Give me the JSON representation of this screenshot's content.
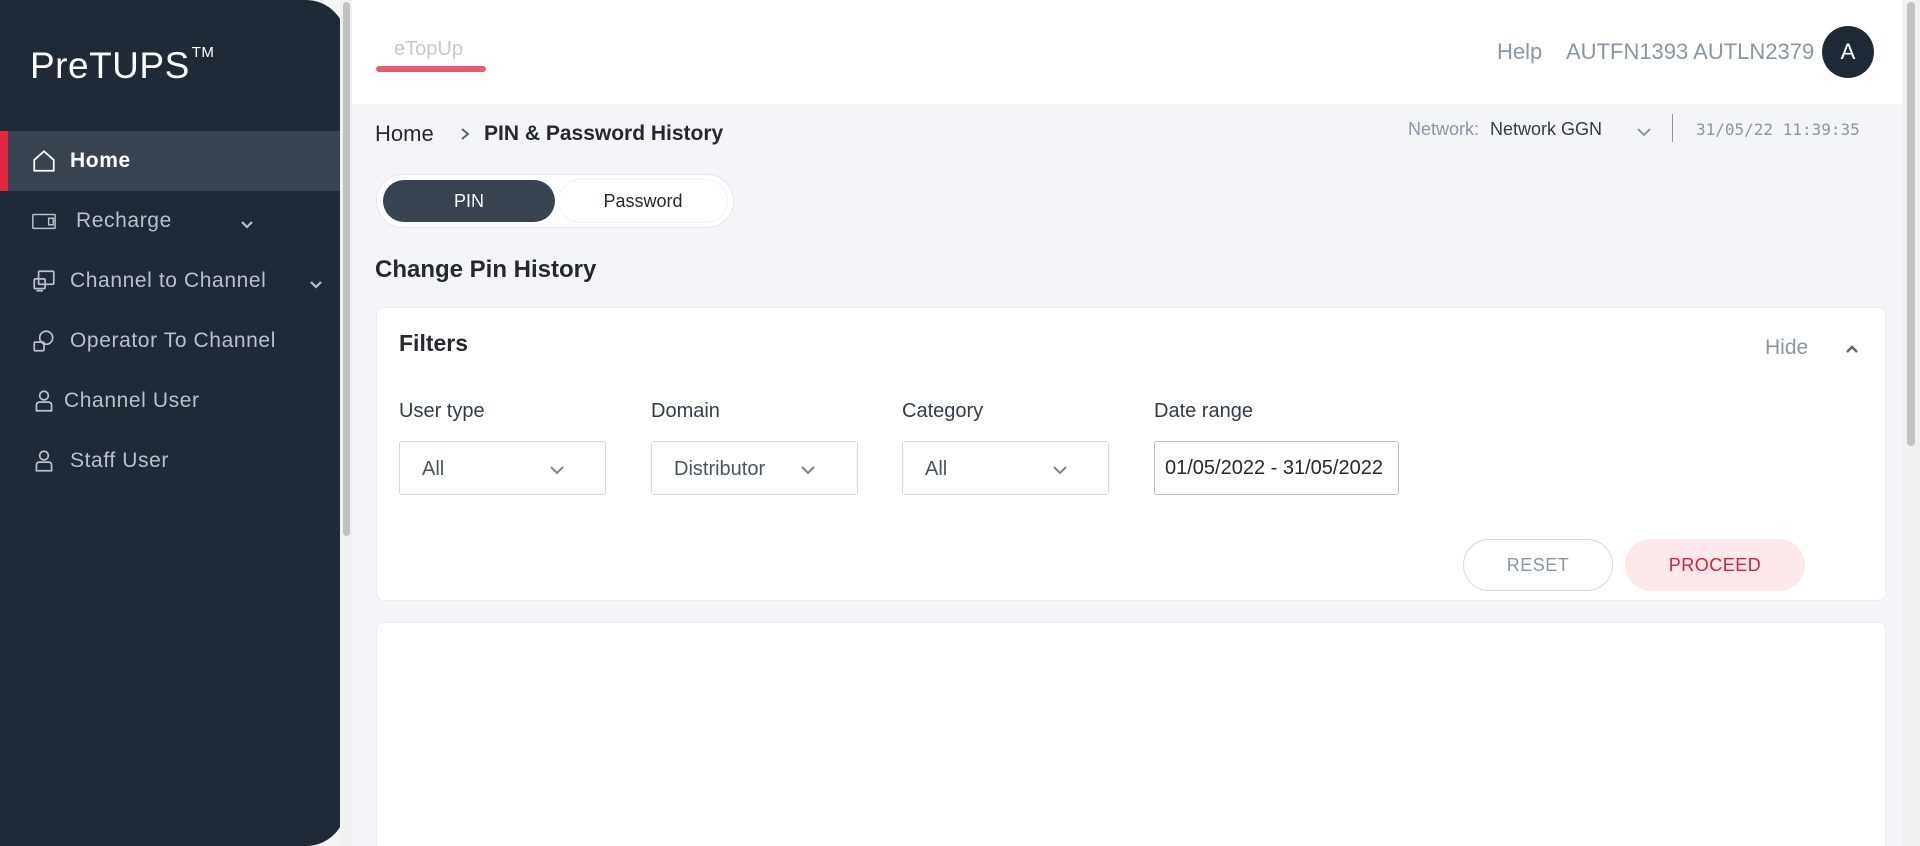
{
  "sidebar": {
    "logo": "PreTUPS",
    "logo_mark": "TM",
    "items": [
      {
        "label": "Home",
        "icon": "home-icon",
        "active": true
      },
      {
        "label": "Recharge",
        "icon": "recharge-icon",
        "has_submenu": true
      },
      {
        "label": "Channel to Channel",
        "icon": "channel-transfer-icon",
        "has_submenu": true
      },
      {
        "label": "Operator To Channel",
        "icon": "operator-icon"
      },
      {
        "label": "Channel User",
        "icon": "user-icon"
      },
      {
        "label": "Staff User",
        "icon": "user-icon"
      }
    ]
  },
  "header": {
    "app_tab": "eTopUp",
    "help": "Help",
    "user_name": "AUTFN1393 AUTLN2379",
    "avatar_initial": "A"
  },
  "breadcrumb": {
    "home": "Home",
    "current": "PIN & Password History"
  },
  "network": {
    "label": "Network:",
    "value": "Network GGN",
    "datetime": "31/05/22 11:39:35"
  },
  "toggle": {
    "options": [
      "PIN",
      "Password"
    ],
    "selected": "PIN"
  },
  "page_title": "Change Pin History",
  "filters": {
    "title": "Filters",
    "hide_label": "Hide",
    "user_type": {
      "label": "User type",
      "value": "All"
    },
    "domain": {
      "label": "Domain",
      "value": "Distributor"
    },
    "category": {
      "label": "Category",
      "value": "All"
    },
    "date_range": {
      "label": "Date range",
      "value": "01/05/2022 - 31/05/2022"
    },
    "reset_label": "RESET",
    "proceed_label": "PROCEED"
  },
  "colors": {
    "sidebar_bg": "#1f2a36",
    "accent": "#e3263f",
    "proceed_bg": "#fde8ea"
  }
}
